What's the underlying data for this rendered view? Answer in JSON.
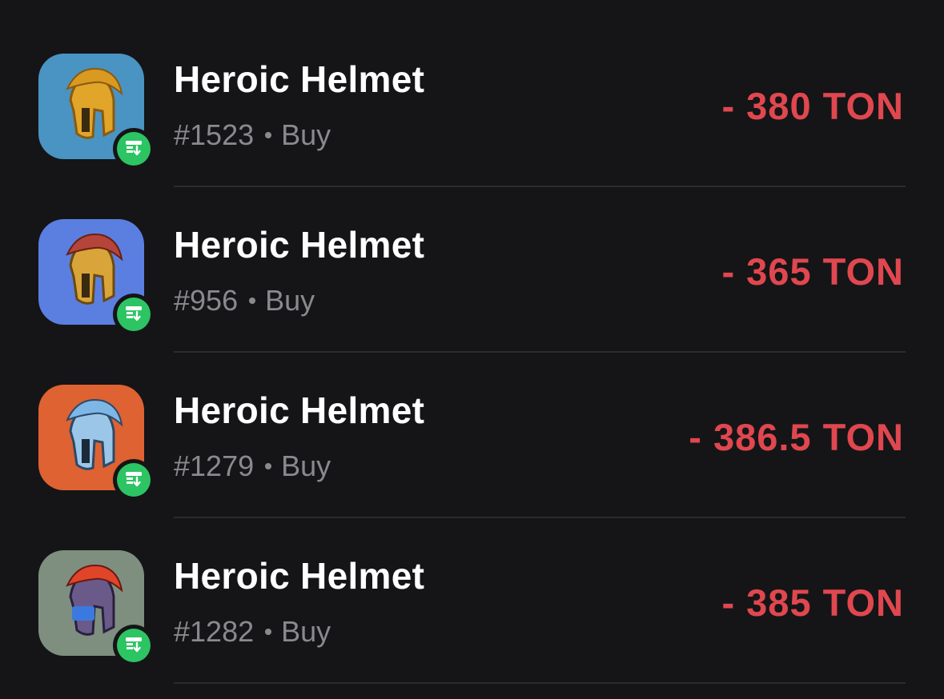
{
  "transactions": [
    {
      "title": "Heroic Helmet",
      "number": "#1523",
      "type": "Buy",
      "amount": "- 380 TON",
      "thumb_bg": "#4a94c4",
      "helmet_color": "#e0a529",
      "crest_color": "#d89a20"
    },
    {
      "title": "Heroic Helmet",
      "number": "#956",
      "type": "Buy",
      "amount": "- 365 TON",
      "thumb_bg": "#5b7fe0",
      "helmet_color": "#d9a43a",
      "crest_color": "#b5443a"
    },
    {
      "title": "Heroic Helmet",
      "number": "#1279",
      "type": "Buy",
      "amount": "- 386.5 TON",
      "thumb_bg": "#de6232",
      "helmet_color": "#9cc6e8",
      "crest_color": "#7eb6e6"
    },
    {
      "title": "Heroic Helmet",
      "number": "#1282",
      "type": "Buy",
      "amount": "- 385 TON",
      "thumb_bg": "#7e8f80",
      "helmet_color": "#6a5a8a",
      "crest_color": "#e0452a"
    }
  ],
  "colors": {
    "background": "#151517",
    "title": "#ffffff",
    "subtitle": "#8a8a8e",
    "amount_negative": "#e0474f",
    "badge": "#2dc463",
    "divider": "#2c2c2f"
  },
  "icons": {
    "thumbnail": "helmet-icon",
    "badge": "market-buy-icon"
  }
}
